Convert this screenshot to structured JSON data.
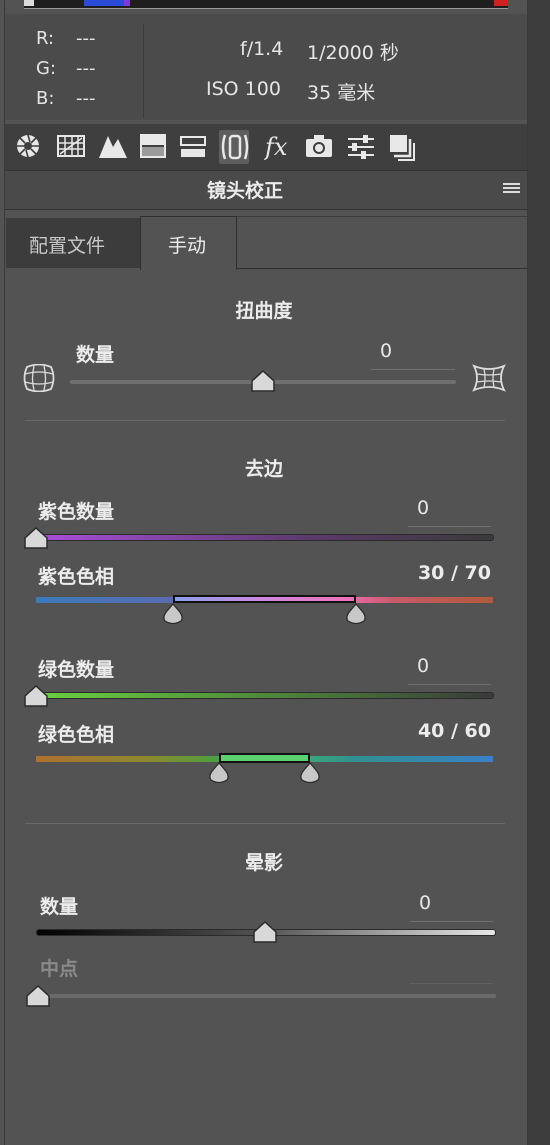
{
  "info": {
    "rgb": [
      {
        "label": "R:",
        "value": "---"
      },
      {
        "label": "G:",
        "value": "---"
      },
      {
        "label": "B:",
        "value": "---"
      }
    ],
    "aperture": "f/1.4",
    "shutter": "1/2000 秒",
    "iso": "ISO 100",
    "focal": "35 毫米"
  },
  "toolbar": {
    "icons": [
      "aperture-icon",
      "grid-icon",
      "mountains-icon",
      "split-tone-icon",
      "detail-icon",
      "lens-correction-icon",
      "fx-icon",
      "camera-icon",
      "sliders-icon",
      "presets-icon"
    ],
    "active": "lens-correction-icon"
  },
  "panel": {
    "title": "镜头校正"
  },
  "tabs": {
    "profile": "配置文件",
    "manual": "手动",
    "active": "manual"
  },
  "distortion": {
    "title": "扭曲度",
    "amount_label": "数量",
    "amount_value": "0",
    "amount_fraction": 0.5
  },
  "defringe": {
    "title": "去边",
    "purple_amount_label": "紫色数量",
    "purple_amount_value": "0",
    "purple_amount_fraction": 0,
    "purple_hue_label": "紫色色相",
    "purple_hue_value": "30 / 70",
    "purple_hue_range": [
      30,
      70
    ],
    "green_amount_label": "绿色数量",
    "green_amount_value": "0",
    "green_amount_fraction": 0,
    "green_hue_label": "绿色色相",
    "green_hue_value": "40 / 60",
    "green_hue_range": [
      40,
      60
    ]
  },
  "vignetting": {
    "title": "晕影",
    "amount_label": "数量",
    "amount_value": "0",
    "amount_fraction": 0.5,
    "midpoint_label": "中点",
    "midpoint_value": "",
    "midpoint_fraction": 0
  },
  "colors": {
    "panel_bg": "#535353",
    "dark_bg": "#3f3f3f",
    "text": "#ececec"
  }
}
